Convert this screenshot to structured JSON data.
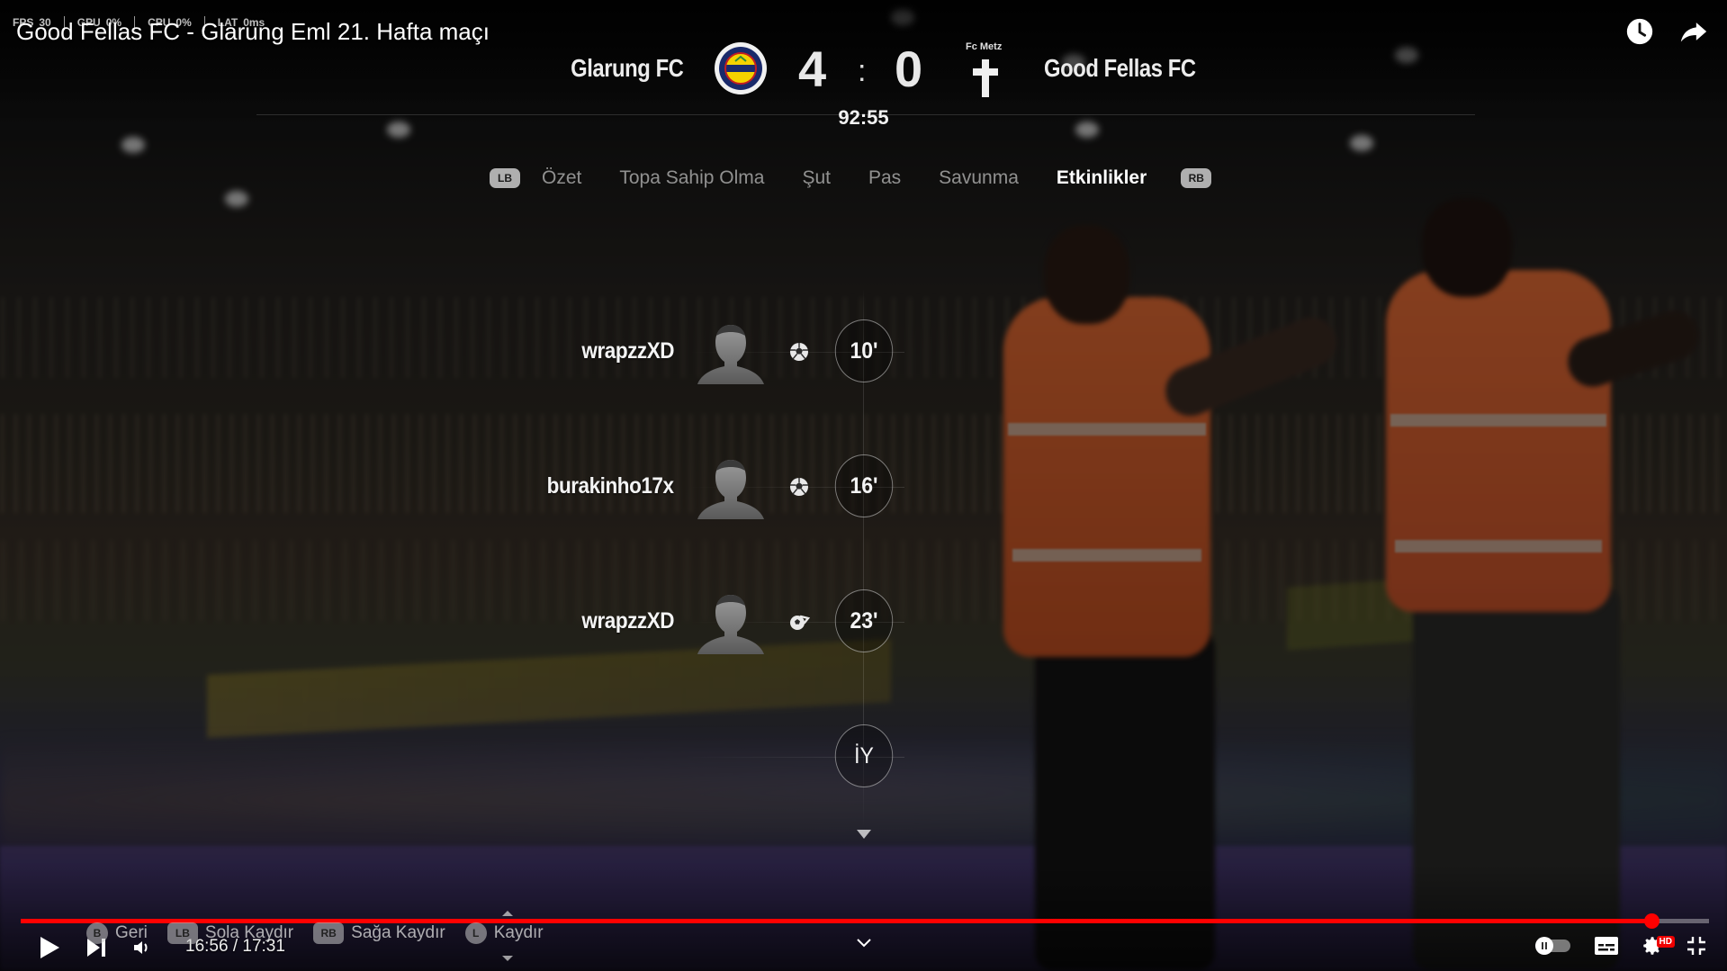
{
  "perf_overlay": {
    "fps_label": "FPS",
    "fps_value": "30",
    "gpu_label": "GPU",
    "gpu_value": "0%",
    "cpu_label": "CPU",
    "cpu_value": "0%",
    "lat_label": "LAT",
    "lat_value": "0ms"
  },
  "video": {
    "title": "Good Fellas FC - Glarung Eml 21. Hafta maçı"
  },
  "scoreboard": {
    "home_team": "Glarung FC",
    "away_team": "Good Fellas FC",
    "away_crest_label": "Fc Metz",
    "home_score": "4",
    "separator": ":",
    "away_score": "0",
    "clock": "92:55"
  },
  "tabs": {
    "left_bumper": "LB",
    "right_bumper": "RB",
    "items": [
      {
        "label": "Özet",
        "active": false
      },
      {
        "label": "Topa Sahip Olma",
        "active": false
      },
      {
        "label": "Şut",
        "active": false
      },
      {
        "label": "Pas",
        "active": false
      },
      {
        "label": "Savunma",
        "active": false
      },
      {
        "label": "Etkinlikler",
        "active": true
      }
    ]
  },
  "events": [
    {
      "player": "wrapzzXD",
      "minute": "10'",
      "icon": "goal-ball-icon"
    },
    {
      "player": "burakinho17x",
      "minute": "16'",
      "icon": "goal-ball-icon"
    },
    {
      "player": "wrapzzXD",
      "minute": "23'",
      "icon": "assist-ball-icon"
    },
    {
      "player": "",
      "minute": "İY",
      "icon": "half-time-marker"
    }
  ],
  "controller_hints": [
    {
      "button": "B",
      "label": "Geri"
    },
    {
      "button": "LB",
      "label": "Sola Kaydır"
    },
    {
      "button": "RB",
      "label": "Sağa Kaydır"
    },
    {
      "button": "L",
      "label": "Kaydır"
    }
  ],
  "player_controls": {
    "current_time": "16:56",
    "duration": "17:31",
    "time_separator": " / ",
    "progress_fraction": 0.966,
    "hd_label": "HD"
  },
  "colors": {
    "progress": "#ff0000",
    "text": "#ffffff",
    "inactive_tab": "#e1e1e1"
  }
}
